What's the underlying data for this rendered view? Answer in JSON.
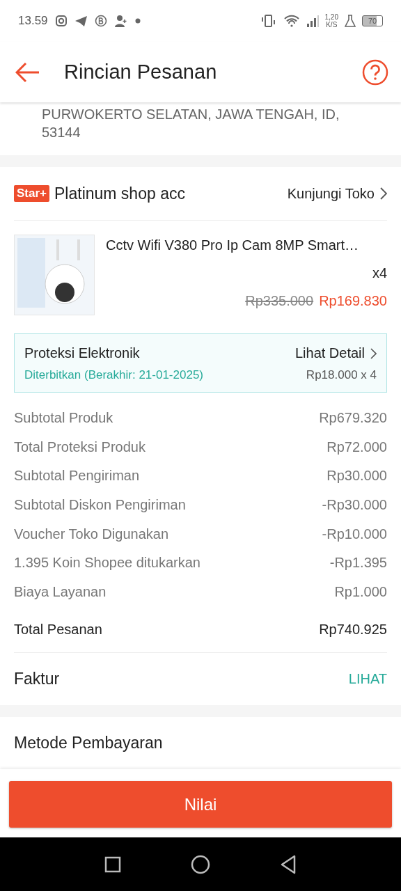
{
  "status_bar": {
    "time": "13.59",
    "net_speed": "1,20",
    "net_unit": "K/S",
    "battery": "70"
  },
  "header": {
    "title": "Rincian Pesanan"
  },
  "address": {
    "text": "PURWOKERTO SELATAN, JAWA TENGAH, ID, 53144"
  },
  "shop": {
    "badge": "Star+",
    "name": "Platinum shop acc",
    "link": "Kunjungi Toko"
  },
  "product": {
    "name": "Cctv Wifi V380 Pro Ip Cam 8MP Smart…",
    "quantity": "x4",
    "original_price": "Rp335.000",
    "price": "Rp169.830"
  },
  "protection": {
    "title": "Proteksi Elektronik",
    "link": "Lihat Detail",
    "status": "Diterbitkan (Berakhir: 21-01-2025)",
    "price": "Rp18.000 x 4"
  },
  "summary": [
    {
      "label": "Subtotal Produk",
      "value": "Rp679.320"
    },
    {
      "label": "Total Proteksi Produk",
      "value": "Rp72.000"
    },
    {
      "label": "Subtotal Pengiriman",
      "value": "Rp30.000"
    },
    {
      "label": "Subtotal Diskon Pengiriman",
      "value": "-Rp30.000"
    },
    {
      "label": "Voucher Toko Digunakan",
      "value": "-Rp10.000"
    },
    {
      "label": "1.395 Koin Shopee ditukarkan",
      "value": "-Rp1.395"
    },
    {
      "label": "Biaya Layanan",
      "value": "Rp1.000"
    }
  ],
  "total": {
    "label": "Total Pesanan",
    "value": "Rp740.925"
  },
  "invoice": {
    "label": "Faktur",
    "action": "LIHAT"
  },
  "payment": {
    "title": "Metode Pembayaran"
  },
  "button": {
    "label": "Nilai"
  }
}
